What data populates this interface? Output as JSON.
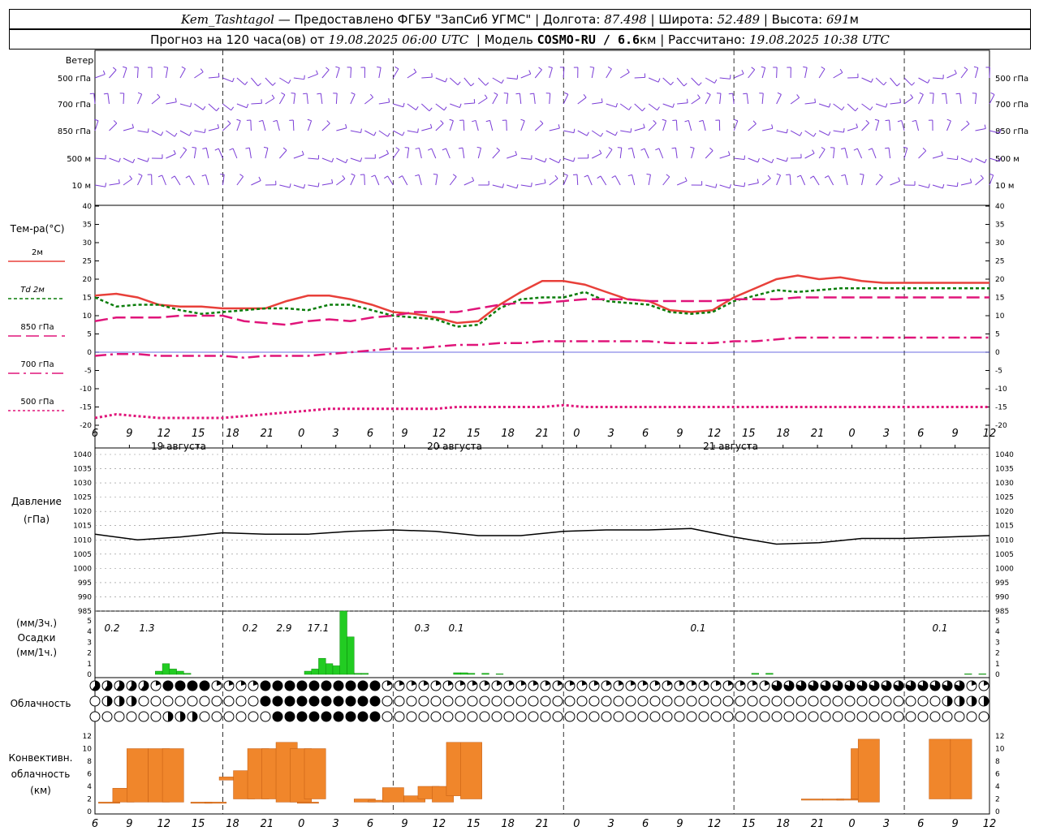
{
  "header": {
    "station": "Kem_Tashtagol",
    "provider": "— Предоставлено ФГБУ \"ЗапСиб УГМС\"",
    "lon_label": "Долгота:",
    "lon": "87.498",
    "lat_label": "Широта:",
    "lat": "52.489",
    "alt_label": "Высота:",
    "alt": "691",
    "alt_unit": "м",
    "forecast_label": "Прогноз на 120 часа(ов) от",
    "forecast_start": "19.08.2025 06:00 UTC",
    "model_label": "Модель",
    "model": "COSMO-RU / 6.6",
    "model_unit": "км",
    "calc_label": "Рассчитано:",
    "calc_time": "19.08.2025 10:38 UTC"
  },
  "wind": {
    "title": "Ветер",
    "levels": [
      "500 гПа",
      "700 гПа",
      "850 гПа",
      "500 м",
      "10  м"
    ]
  },
  "temp": {
    "title": "Тем-ра(°C)",
    "legend": [
      "2м",
      "Td  2м",
      "850 гПа",
      "700 гПа",
      "500 гПа"
    ],
    "ticks": [
      "40",
      "35",
      "30",
      "25",
      "20",
      "15",
      "10",
      "5",
      "0",
      "-5",
      "-10",
      "-15",
      "-20"
    ]
  },
  "time_axis": {
    "hours": [
      "6",
      "9",
      "12",
      "15",
      "18",
      "21",
      "0",
      "3",
      "6",
      "9",
      "12",
      "15",
      "18",
      "21",
      "0",
      "3",
      "6",
      "9",
      "12",
      "15",
      "18",
      "21",
      "0",
      "3",
      "6",
      "9",
      "12"
    ],
    "days": [
      "19 августа",
      "20 августа",
      "21 августа"
    ]
  },
  "pressure": {
    "title": "Давление",
    "unit": "(гПа)",
    "ticks": [
      "1040",
      "1035",
      "1030",
      "1025",
      "1020",
      "1015",
      "1010",
      "1005",
      "1000",
      "995",
      "990",
      "985"
    ]
  },
  "precip": {
    "label1": "(мм/3ч.)",
    "label2": "Осадки",
    "label3": "(мм/1ч.)",
    "ticks": [
      "5",
      "4",
      "3",
      "2",
      "1",
      "0"
    ],
    "totals": [
      "0.2",
      "1.3",
      "0.2",
      "2.9",
      "17.1",
      "0.3",
      "0.1",
      "0.1",
      "0.1"
    ]
  },
  "clouds": {
    "title": "Облачность"
  },
  "convective": {
    "title1": "Конвективн.",
    "title2": "облачность",
    "title3": "(км)",
    "ticks": [
      "12",
      "10",
      "8",
      "6",
      "4",
      "2",
      "0"
    ]
  },
  "colors": {
    "temp2m": "#e8403a",
    "td2m": "#0a7d0a",
    "t850": "#e0157a",
    "precip": "#22cc22",
    "conv": "#f0862b",
    "wind": "#7a3cd6",
    "axis": "#000000"
  },
  "chart_data": [
    {
      "type": "line",
      "title": "Тем-ра(°C)",
      "x_hours": [
        0,
        3,
        6,
        9,
        12,
        15,
        18,
        21,
        24,
        27,
        30,
        33,
        36,
        39,
        42,
        45,
        48,
        51,
        54,
        57,
        60,
        63,
        66,
        69,
        72,
        75,
        78,
        81,
        84,
        87,
        90,
        93,
        96,
        99,
        102,
        105,
        108,
        111,
        114,
        117,
        120,
        123,
        126
      ],
      "ylim": [
        -20,
        40
      ],
      "series": [
        {
          "name": "2м",
          "values": [
            15.5,
            16,
            15,
            13,
            12.5,
            12.5,
            12,
            12,
            12,
            14,
            15.5,
            15.5,
            14.5,
            13,
            11,
            10.5,
            9.5,
            8,
            8.5,
            13,
            16.5,
            19.5,
            19.5,
            18.5,
            16.5,
            14.5,
            14,
            11.5,
            11,
            11.5,
            15,
            17.5,
            20,
            21,
            20,
            20.5,
            19.5,
            19,
            19,
            19,
            19,
            19,
            19
          ]
        },
        {
          "name": "Td  2м",
          "values": [
            15,
            12.5,
            13,
            13,
            11.5,
            10.5,
            11,
            11.5,
            12,
            12,
            11.5,
            13,
            13,
            11.5,
            10,
            9.5,
            9,
            7,
            7.5,
            12,
            14.5,
            15,
            15,
            16.5,
            14,
            13.5,
            13,
            11,
            10.5,
            11,
            14,
            15.5,
            17,
            16.5,
            17,
            17.5,
            17.5,
            17.5,
            17.5,
            17.5,
            17.5,
            17.5,
            17.5
          ]
        },
        {
          "name": "850 гПа",
          "values": [
            8.5,
            9.5,
            9.5,
            9.5,
            10,
            10,
            10,
            8.5,
            8,
            7.5,
            8.5,
            9,
            8.5,
            9.5,
            10,
            11,
            11,
            11,
            12,
            13,
            13.5,
            13.5,
            14,
            14.5,
            14.5,
            14.5,
            14,
            14,
            14,
            14,
            14.5,
            14.5,
            14.5,
            15,
            15,
            15,
            15,
            15,
            15,
            15,
            15,
            15,
            15
          ]
        },
        {
          "name": "700 гПа",
          "values": [
            -1,
            -0.5,
            -0.5,
            -1,
            -1,
            -1,
            -1,
            -1.5,
            -1,
            -1,
            -1,
            -0.5,
            0,
            0.5,
            1,
            1,
            1.5,
            2,
            2,
            2.5,
            2.5,
            3,
            3,
            3,
            3,
            3,
            3,
            2.5,
            2.5,
            2.5,
            3,
            3,
            3.5,
            4,
            4,
            4,
            4,
            4,
            4,
            4,
            4,
            4,
            4
          ]
        },
        {
          "name": "500 гПа",
          "values": [
            -18,
            -17,
            -17.5,
            -18,
            -18,
            -18,
            -18,
            -17.5,
            -17,
            -16.5,
            -16,
            -15.5,
            -15.5,
            -15.5,
            -15.5,
            -15.5,
            -15.5,
            -15,
            -15,
            -15,
            -15,
            -15,
            -14.5,
            -15,
            -15,
            -15,
            -15,
            -15,
            -15,
            -15,
            -15,
            -15,
            -15,
            -15,
            -15,
            -15,
            -15,
            -15,
            -15,
            -15,
            -15,
            -15,
            -15
          ]
        }
      ]
    },
    {
      "type": "line",
      "title": "Давление",
      "ylabel": "(гПа)",
      "ylim": [
        985,
        1040
      ],
      "x_hours": [
        0,
        6,
        12,
        18,
        24,
        30,
        36,
        42,
        48,
        54,
        60,
        66,
        72,
        78,
        84,
        90,
        96,
        102,
        108,
        114,
        120,
        126
      ],
      "values": [
        1012,
        1010,
        1011,
        1012.5,
        1012,
        1012,
        1013,
        1013.5,
        1013,
        1011.5,
        1011.5,
        1013,
        1013.5,
        1013.5,
        1014,
        1011,
        1008.5,
        1009,
        1010.5,
        1010.5,
        1011,
        1011.5
      ]
    },
    {
      "type": "bar",
      "title": "Осадки",
      "ylabel": "(мм/1ч.)",
      "ylim": [
        0,
        5
      ],
      "x_hours": [
        9,
        10,
        11,
        12,
        13,
        30,
        31,
        32,
        33,
        34,
        35,
        36,
        37,
        38,
        51,
        52,
        53,
        55,
        57,
        93,
        95,
        123,
        125
      ],
      "values": [
        0.3,
        1.0,
        0.5,
        0.3,
        0.1,
        0.3,
        0.5,
        1.5,
        1.0,
        0.8,
        6.0,
        3.5,
        0.1,
        0.1,
        0.15,
        0.15,
        0.1,
        0.1,
        0.05,
        0.1,
        0.1,
        0.05,
        0.05
      ]
    },
    {
      "type": "bar",
      "title": "Конвективн. облачность",
      "ylabel": "(км)",
      "ylim": [
        0,
        12
      ],
      "x_hours": [
        2,
        4,
        6,
        9,
        11,
        15,
        17,
        19,
        21,
        23,
        25,
        27,
        29,
        30,
        31,
        38,
        40,
        42,
        45,
        47,
        49,
        51,
        53,
        101,
        104,
        106,
        108,
        109,
        119,
        122
      ],
      "base": [
        1.5,
        1.5,
        1.5,
        1.5,
        1.5,
        1.5,
        1.5,
        5,
        2,
        2,
        2,
        1.5,
        1.5,
        1.5,
        2,
        1.5,
        1.5,
        1.5,
        1.5,
        2,
        1.5,
        2.5,
        2,
        2,
        2,
        2,
        2,
        1.5,
        2,
        2
      ],
      "top": [
        1.5,
        3.7,
        10,
        10,
        10,
        1.5,
        1.5,
        5.5,
        6.5,
        10,
        10,
        11,
        10,
        1.5,
        10,
        2,
        1.8,
        3.8,
        2.5,
        4,
        4,
        11,
        11,
        2,
        2,
        2,
        10,
        11.5,
        11.5,
        11.5
      ]
    }
  ]
}
